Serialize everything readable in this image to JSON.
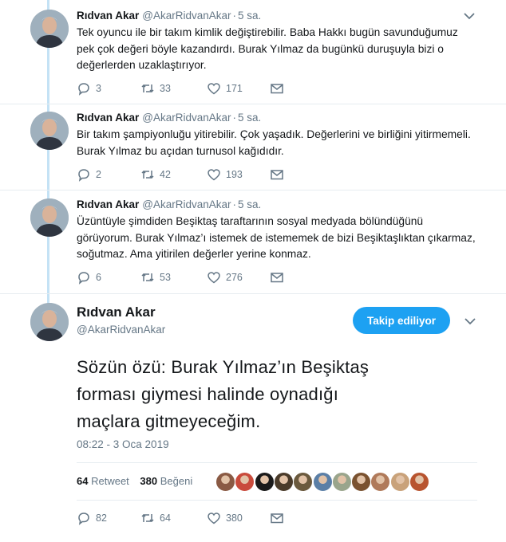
{
  "tweets": [
    {
      "name": "Rıdvan Akar",
      "handle": "@AkarRidvanAkar",
      "sep": "·",
      "time": "5 sa.",
      "lines": [
        "Tek oyuncu ile bir takım kimlik değiştirebilir. Baba Hakkı bugün savunduğumuz",
        "pek çok değeri böyle kazandırdı. Burak Yılmaz da bugünkü duruşuyla bizi o",
        "değerlerden uzaklaştırıyor."
      ],
      "replies": "3",
      "retweets": "33",
      "likes": "171"
    },
    {
      "name": "Rıdvan Akar",
      "handle": "@AkarRidvanAkar",
      "sep": "·",
      "time": "5 sa.",
      "lines": [
        "Bir takım şampiyonluğu yitirebilir. Çok yaşadık. Değerlerini ve birliğini yitirmemeli.",
        "Burak Yılmaz bu açıdan turnusol kağıdıdır."
      ],
      "replies": "2",
      "retweets": "42",
      "likes": "193"
    },
    {
      "name": "Rıdvan Akar",
      "handle": "@AkarRidvanAkar",
      "sep": "·",
      "time": "5 sa.",
      "lines": [
        "Üzüntüyle şimdiden Beşiktaş taraftarının sosyal medyada bölündüğünü",
        "görüyorum. Burak Yılmaz’ı istemek de istememek de bizi Beşiktaşlıktan çıkarmaz,",
        "soğutmaz. Ama yitirilen değerler yerine konmaz."
      ],
      "replies": "6",
      "retweets": "53",
      "likes": "276"
    }
  ],
  "focus": {
    "name": "Rıdvan Akar",
    "handle": "@AkarRidvanAkar",
    "follow_label": "Takip ediliyor",
    "lines": [
      "Sözün özü: Burak Yılmaz’ın Beşiktaş",
      "forması giymesi halinde oynadığı",
      "maçlara gitmeyeceğim."
    ],
    "timestamp": "08:22 - 3 Oca 2019",
    "retweet_count": "64",
    "retweet_label": "Retweet",
    "like_count": "380",
    "like_label": "Beğeni",
    "replies": "82",
    "retweets": "64",
    "likes": "380"
  },
  "icons": {
    "reply": "reply-icon",
    "retweet": "retweet-icon",
    "like": "heart-icon",
    "dm": "envelope-icon",
    "caret": "chevron-down-icon"
  },
  "colors": {
    "accent": "#1da1f2",
    "thread_line": "#c4e2f5",
    "secondary_text": "#657786",
    "primary_text": "#14171a"
  },
  "liker_colors": [
    "#8a5a44",
    "#c94b3c",
    "#1a1a1a",
    "#4a3b2a",
    "#6b5a3e",
    "#5b7fa6",
    "#9aa58c",
    "#7a5230",
    "#b07a5a",
    "#c9a27a",
    "#b8542f"
  ]
}
